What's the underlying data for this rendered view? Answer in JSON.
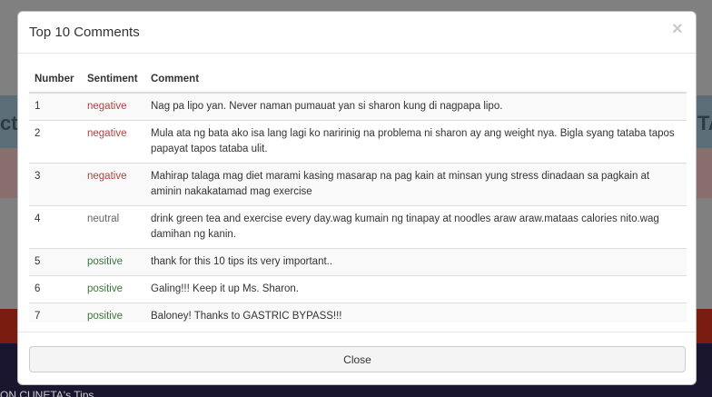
{
  "background": {
    "left_edge_text": "ct",
    "right_edge_text": "TA",
    "caption": "ON CUNETA's Tips"
  },
  "modal": {
    "title": "Top 10 Comments",
    "close_icon": "×",
    "close_button_label": "Close",
    "table": {
      "headers": [
        "Number",
        "Sentiment",
        "Comment"
      ],
      "rows": [
        {
          "number": "1",
          "sentiment": "negative",
          "comment": "Nag pa lipo yan. Never naman pumauat yan si sharon kung di nagpapa lipo."
        },
        {
          "number": "2",
          "sentiment": "negative",
          "comment": "Mula ata ng bata ako isa lang lagi ko naririnig na problema ni sharon ay ang weight nya. Bigla syang tataba tapos papayat tapos tataba ulit."
        },
        {
          "number": "3",
          "sentiment": "negative",
          "comment": "Mahirap talaga mag diet marami kasing masarap na pag kain at minsan yung stress dinadaan sa pagkain at aminin nakakatamad mag exercise"
        },
        {
          "number": "4",
          "sentiment": "neutral",
          "comment": "drink green tea and exercise every day.wag kumain ng tinapay at noodles araw araw.mataas calories nito.wag damihan ng kanin."
        },
        {
          "number": "5",
          "sentiment": "positive",
          "comment": "thank for this 10 tips its very important.."
        },
        {
          "number": "6",
          "sentiment": "positive",
          "comment": "Galing!!! Keep it up Ms. Sharon."
        },
        {
          "number": "7",
          "sentiment": "positive",
          "comment": "Baloney! Thanks to GASTRIC BYPASS!!!"
        }
      ]
    }
  },
  "colors": {
    "negative": "#a94442",
    "neutral": "#666666",
    "positive": "#3c763d"
  }
}
